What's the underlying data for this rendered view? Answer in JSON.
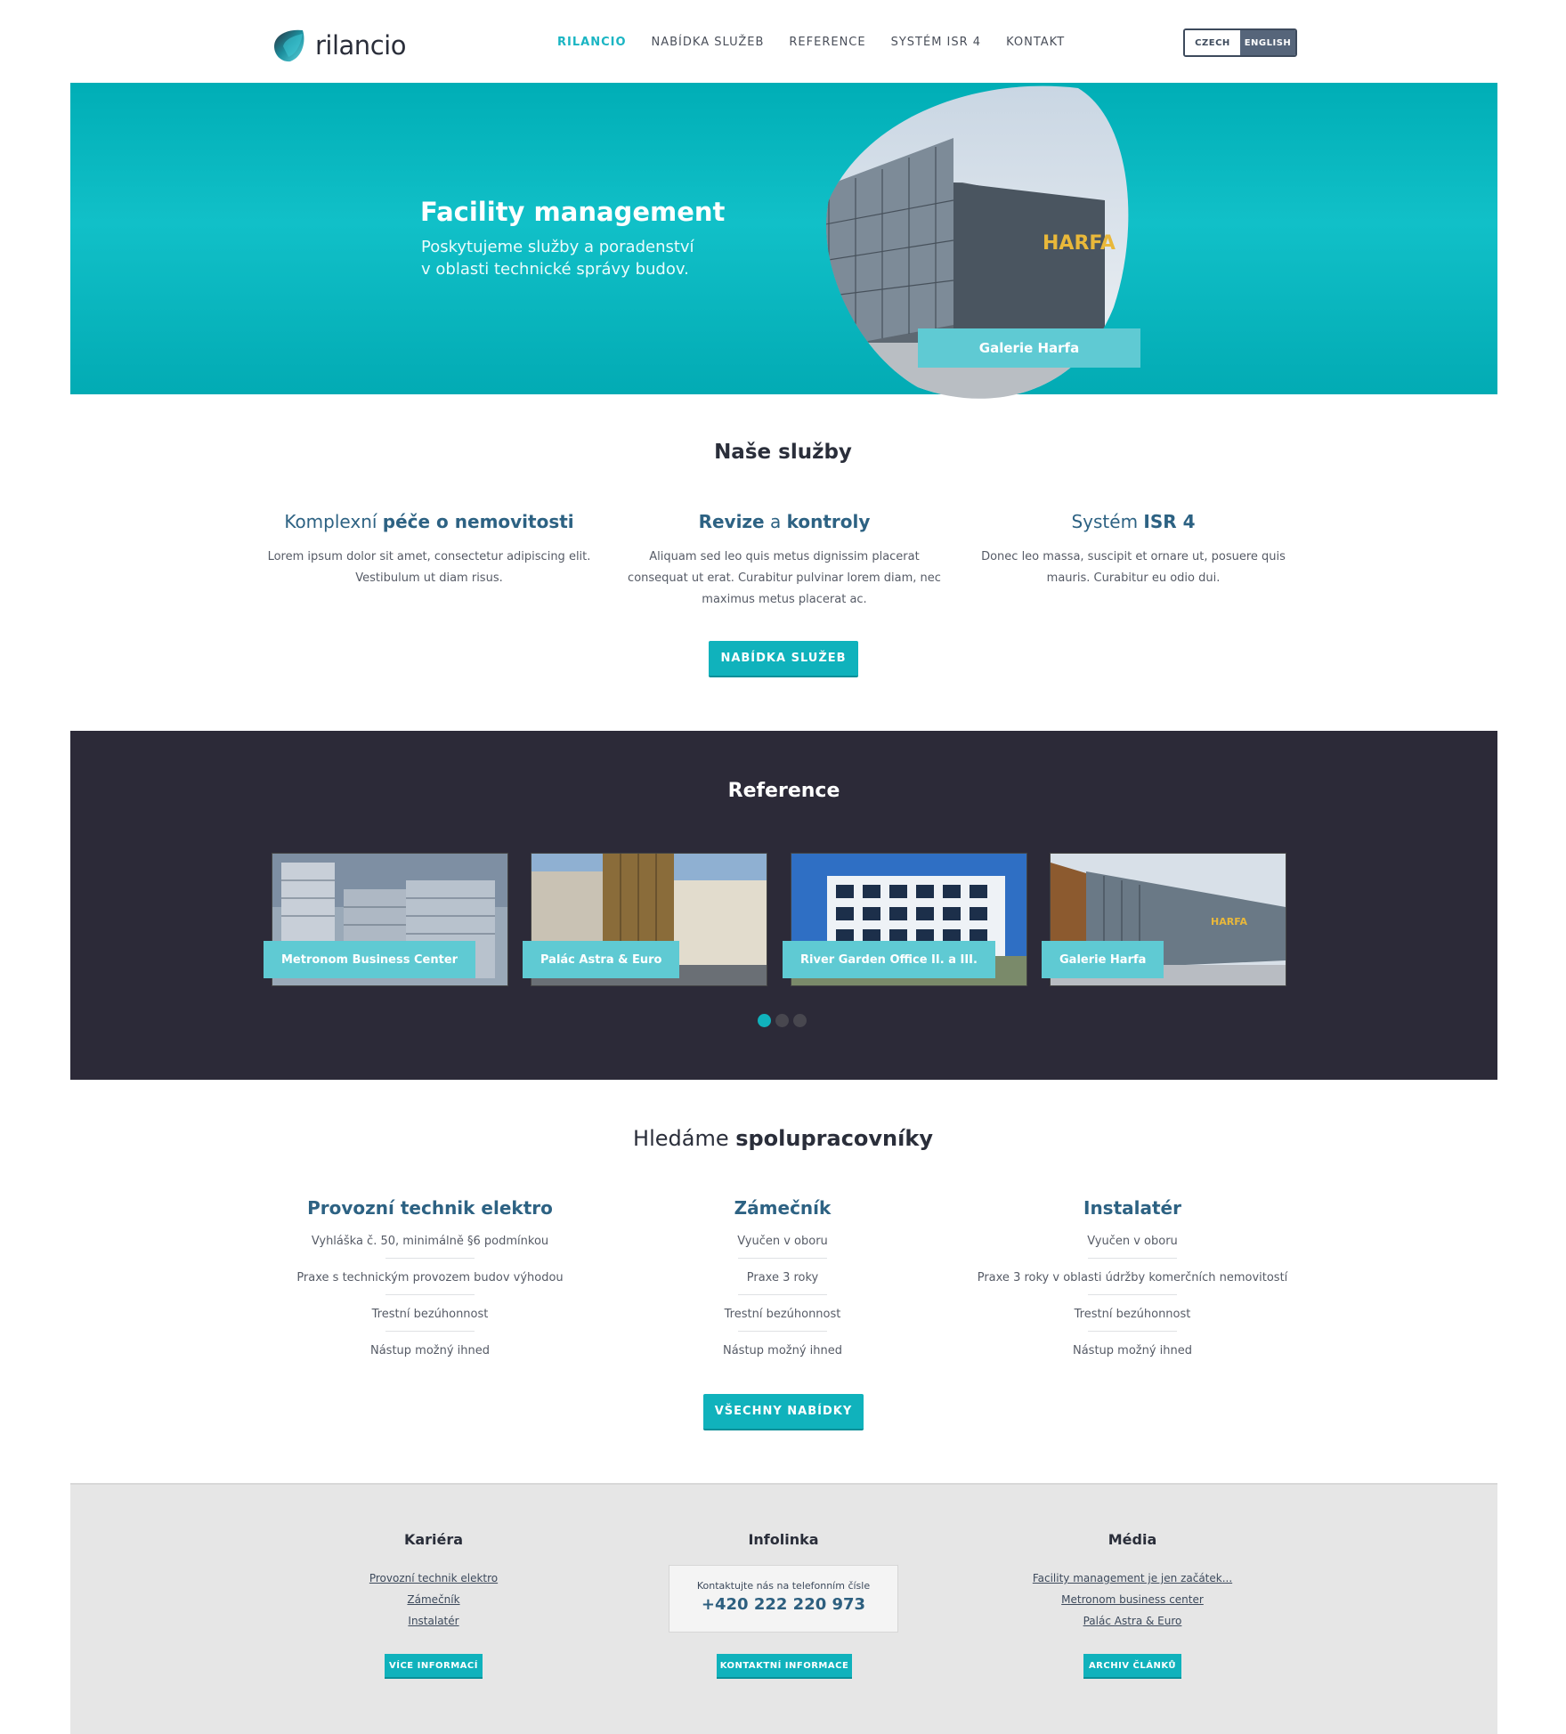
{
  "header": {
    "logo_text": "rilancio",
    "nav": [
      "RILANCIO",
      "NABÍDKA SLUŽEB",
      "REFERENCE",
      "SYSTÉM ISR 4",
      "KONTAKT"
    ],
    "lang": [
      "CZECH",
      "ENGLISH"
    ]
  },
  "hero": {
    "title": "Facility management",
    "subtitle_line1": "Poskytujeme služby a poradenství",
    "subtitle_line2": "v oblasti technické správy budov.",
    "photo_caption": "Galerie Harfa",
    "photo_sign": "HARFA"
  },
  "services": {
    "title": "Naše služby",
    "items": [
      {
        "pre": "Komplexní ",
        "bold": "péče o nemovitosti",
        "post": "",
        "text": "Lorem ipsum dolor sit amet, consectetur adipiscing elit. Vestibulum ut diam risus."
      },
      {
        "pre": "",
        "bold": "Revize",
        "mid": " a ",
        "bold2": "kontroly",
        "text": "Aliquam sed leo quis metus dignissim placerat consequat ut erat. Curabitur pulvinar lorem diam, nec maximus metus placerat ac."
      },
      {
        "pre": "Systém ",
        "bold": "ISR 4",
        "post": "",
        "text": "Donec leo massa, suscipit et ornare ut, posuere quis mauris. Curabitur eu odio dui."
      }
    ],
    "button": "NABÍDKA SLUŽEB"
  },
  "references": {
    "title": "Reference",
    "items": [
      "Metronom Business Center",
      "Palác Astra & Euro",
      "River Garden Office II. a III.",
      "Galerie Harfa"
    ],
    "harfa_sign": "HARFA"
  },
  "jobs": {
    "title_pre": "Hledáme ",
    "title_bold": "spolupracovníky",
    "items": [
      {
        "title": "Provozní technik elektro",
        "reqs": [
          "Vyhláška č. 50, minimálně §6 podmínkou",
          "Praxe s technickým provozem budov výhodou",
          "Trestní bezúhonnost",
          "Nástup možný ihned"
        ]
      },
      {
        "title": "Zámečník",
        "reqs": [
          "Vyučen v oboru",
          "Praxe 3 roky",
          "Trestní bezúhonnost",
          "Nástup možný ihned"
        ]
      },
      {
        "title": "Instalatér",
        "reqs": [
          "Vyučen v oboru",
          "Praxe 3 roky v oblasti údržby komerčních nemovitostí",
          "Trestní bezúhonnost",
          "Nástup možný ihned"
        ]
      }
    ],
    "button": "VŠECHNY NABÍDKY"
  },
  "footer": {
    "career": {
      "title": "Kariéra",
      "links": [
        "Provozní technik elektro",
        "Zámečník",
        "Instalatér"
      ],
      "button": "VÍCE INFORMACÍ"
    },
    "infoline": {
      "title": "Infolinka",
      "text": "Kontaktujte nás na telefonním čísle",
      "phone": "+420 222 220 973",
      "button": "KONTAKTNÍ INFORMACE"
    },
    "media": {
      "title": "Média",
      "links": [
        "Facility management je jen začátek...",
        "Metronom business center",
        "Palác Astra & Euro"
      ],
      "button": "ARCHIV ČLÁNKŮ"
    }
  },
  "colors": {
    "accent": "#10b2bc",
    "dark": "#2c2a38",
    "heading": "#2d6283"
  }
}
